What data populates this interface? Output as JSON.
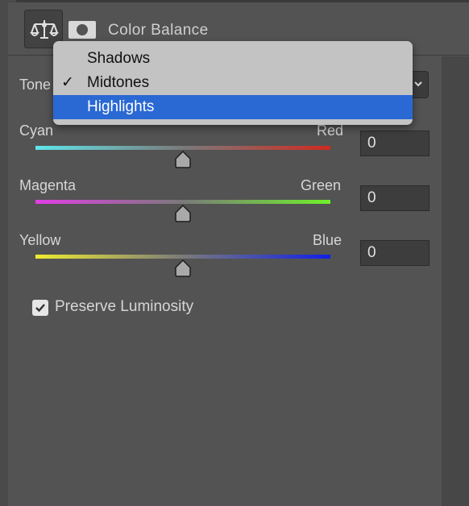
{
  "panel": {
    "title": "Color Balance",
    "icons": [
      "balance-scale-icon",
      "layer-mask-icon"
    ]
  },
  "tone": {
    "label": "Tone",
    "options": [
      {
        "label": "Shadows",
        "checked": false,
        "highlighted": false
      },
      {
        "label": "Midtones",
        "checked": true,
        "highlighted": false
      },
      {
        "label": "Highlights",
        "checked": false,
        "highlighted": true
      }
    ]
  },
  "sliders": [
    {
      "left_label": "Cyan",
      "right_label": "Red",
      "value": "0",
      "gradient": [
        "#5fe6ec",
        "#7a7a7a",
        "#d02a20"
      ]
    },
    {
      "left_label": "Magenta",
      "right_label": "Green",
      "value": "0",
      "gradient": [
        "#e23ee6",
        "#7a7a7a",
        "#6ff02a"
      ]
    },
    {
      "left_label": "Yellow",
      "right_label": "Blue",
      "value": "0",
      "gradient": [
        "#eeec30",
        "#7a7a7a",
        "#1020e8"
      ]
    }
  ],
  "preserve_luminosity": {
    "label": "Preserve Luminosity",
    "checked": true
  },
  "colors": {
    "accent": "#2a68d4",
    "panel_bg": "#535353"
  }
}
